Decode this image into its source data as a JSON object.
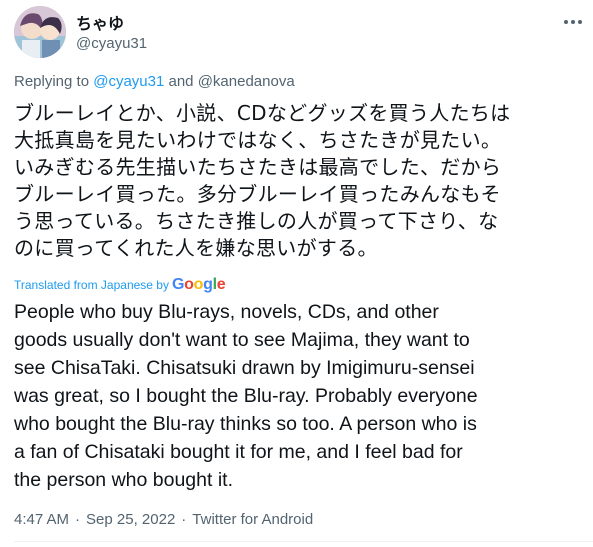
{
  "author": {
    "display_name": "ちゃゆ",
    "handle": "@cyayu31"
  },
  "reply": {
    "prefix": "Replying to ",
    "mention1": "@cyayu31",
    "joiner": " and ",
    "mention2": "@kanedanova"
  },
  "original_lines": [
    "ブルーレイとか、小説、CDなどグッズを買う人たちは",
    "大抵真島を見たいわけではなく、ちさたきが見たい。",
    "いみぎむる先生描いたちさたきは最高でした、だから",
    "ブルーレイ買った。多分ブルーレイ買ったみんなもそ",
    "う思っている。ちさたき推しの人が買って下さり、な",
    "のに買ってくれた人を嫌な思いがする。"
  ],
  "translation_credit": {
    "label": "Translated from Japanese by",
    "provider": "Google"
  },
  "translation_lines": [
    "People who buy Blu-rays, novels, CDs, and other",
    "goods usually don't want to see Majima, they want to",
    "see ChisaTaki. Chisatsuki drawn by Imigimuru-sensei",
    "was great, so I bought the Blu-ray. Probably everyone",
    "who bought the Blu-ray thinks so too. A person who is",
    "a fan of Chisataki bought it for me, and I feel bad for",
    "the person who bought it."
  ],
  "meta": {
    "time": "4:47 AM",
    "date": "Sep 25, 2022",
    "separator": "·",
    "source": "Twitter for Android"
  },
  "icons": {
    "more": "more-options-icon"
  },
  "colors": {
    "link": "#1d9bf0",
    "secondary_text": "#536471",
    "primary_text": "#0f1419"
  }
}
